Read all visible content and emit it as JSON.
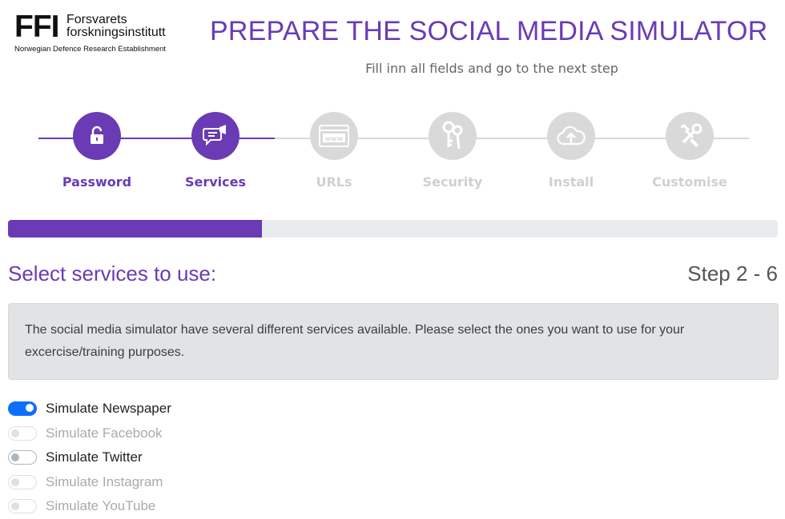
{
  "header": {
    "logo_mark": "FFI",
    "logo_line1": "Forsvarets",
    "logo_line2": "forskningsinstitutt",
    "logo_sub": "Norwegian Defence Research Establishment",
    "title": "PREPARE THE SOCIAL MEDIA SIMULATOR",
    "subtitle": "Fill inn all fields and go to the next step"
  },
  "steps": [
    {
      "label": "Password",
      "icon": "unlock-icon",
      "state": "active"
    },
    {
      "label": "Services",
      "icon": "megaphone-chat-icon",
      "state": "active"
    },
    {
      "label": "URLs",
      "icon": "www-icon",
      "state": "inactive"
    },
    {
      "label": "Security",
      "icon": "keys-icon",
      "state": "inactive"
    },
    {
      "label": "Install",
      "icon": "cloud-upload-icon",
      "state": "inactive"
    },
    {
      "label": "Customise",
      "icon": "tools-icon",
      "state": "inactive"
    }
  ],
  "progress": {
    "fraction": 0.33,
    "color": "#6a3bb5"
  },
  "section": {
    "title": "Select services to use:",
    "step_count": "Step 2 - 6"
  },
  "info_text": "The social media simulator have several different services available. Please select the ones you want to use for your excercise/training purposes.",
  "services": [
    {
      "label": "Simulate Newspaper",
      "checked": true,
      "disabled": false
    },
    {
      "label": "Simulate Facebook",
      "checked": false,
      "disabled": true
    },
    {
      "label": "Simulate Twitter",
      "checked": false,
      "disabled": false
    },
    {
      "label": "Simulate Instagram",
      "checked": false,
      "disabled": true
    },
    {
      "label": "Simulate YouTube",
      "checked": false,
      "disabled": true
    }
  ],
  "colors": {
    "accent": "#6a3bb5",
    "switch_on": "#0d6efd",
    "inactive": "#d9d9d9"
  }
}
